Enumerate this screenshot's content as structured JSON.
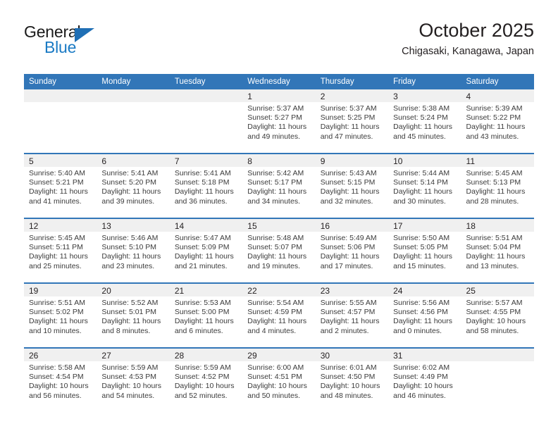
{
  "brand": {
    "name_line1": "General",
    "name_line2": "Blue",
    "primary_color": "#1a7ac4",
    "triangle_color": "#1f6fb5"
  },
  "header": {
    "title": "October 2025",
    "subtitle": "Chigasaki, Kanagawa, Japan"
  },
  "calendar": {
    "header_bg": "#3276b8",
    "daynum_bg": "#f0f0f0",
    "weekday_names": [
      "Sunday",
      "Monday",
      "Tuesday",
      "Wednesday",
      "Thursday",
      "Friday",
      "Saturday"
    ],
    "labels": {
      "sunrise": "Sunrise:",
      "sunset": "Sunset:",
      "daylight": "Daylight:"
    },
    "weeks": [
      [
        {
          "day": "",
          "blank": true
        },
        {
          "day": "",
          "blank": true
        },
        {
          "day": "",
          "blank": true
        },
        {
          "day": "1",
          "sunrise": "Sunrise: 5:37 AM",
          "sunset": "Sunset: 5:27 PM",
          "daylight_line1": "Daylight: 11 hours",
          "daylight_line2": "and 49 minutes."
        },
        {
          "day": "2",
          "sunrise": "Sunrise: 5:37 AM",
          "sunset": "Sunset: 5:25 PM",
          "daylight_line1": "Daylight: 11 hours",
          "daylight_line2": "and 47 minutes."
        },
        {
          "day": "3",
          "sunrise": "Sunrise: 5:38 AM",
          "sunset": "Sunset: 5:24 PM",
          "daylight_line1": "Daylight: 11 hours",
          "daylight_line2": "and 45 minutes."
        },
        {
          "day": "4",
          "sunrise": "Sunrise: 5:39 AM",
          "sunset": "Sunset: 5:22 PM",
          "daylight_line1": "Daylight: 11 hours",
          "daylight_line2": "and 43 minutes."
        }
      ],
      [
        {
          "day": "5",
          "sunrise": "Sunrise: 5:40 AM",
          "sunset": "Sunset: 5:21 PM",
          "daylight_line1": "Daylight: 11 hours",
          "daylight_line2": "and 41 minutes."
        },
        {
          "day": "6",
          "sunrise": "Sunrise: 5:41 AM",
          "sunset": "Sunset: 5:20 PM",
          "daylight_line1": "Daylight: 11 hours",
          "daylight_line2": "and 39 minutes."
        },
        {
          "day": "7",
          "sunrise": "Sunrise: 5:41 AM",
          "sunset": "Sunset: 5:18 PM",
          "daylight_line1": "Daylight: 11 hours",
          "daylight_line2": "and 36 minutes."
        },
        {
          "day": "8",
          "sunrise": "Sunrise: 5:42 AM",
          "sunset": "Sunset: 5:17 PM",
          "daylight_line1": "Daylight: 11 hours",
          "daylight_line2": "and 34 minutes."
        },
        {
          "day": "9",
          "sunrise": "Sunrise: 5:43 AM",
          "sunset": "Sunset: 5:15 PM",
          "daylight_line1": "Daylight: 11 hours",
          "daylight_line2": "and 32 minutes."
        },
        {
          "day": "10",
          "sunrise": "Sunrise: 5:44 AM",
          "sunset": "Sunset: 5:14 PM",
          "daylight_line1": "Daylight: 11 hours",
          "daylight_line2": "and 30 minutes."
        },
        {
          "day": "11",
          "sunrise": "Sunrise: 5:45 AM",
          "sunset": "Sunset: 5:13 PM",
          "daylight_line1": "Daylight: 11 hours",
          "daylight_line2": "and 28 minutes."
        }
      ],
      [
        {
          "day": "12",
          "sunrise": "Sunrise: 5:45 AM",
          "sunset": "Sunset: 5:11 PM",
          "daylight_line1": "Daylight: 11 hours",
          "daylight_line2": "and 25 minutes."
        },
        {
          "day": "13",
          "sunrise": "Sunrise: 5:46 AM",
          "sunset": "Sunset: 5:10 PM",
          "daylight_line1": "Daylight: 11 hours",
          "daylight_line2": "and 23 minutes."
        },
        {
          "day": "14",
          "sunrise": "Sunrise: 5:47 AM",
          "sunset": "Sunset: 5:09 PM",
          "daylight_line1": "Daylight: 11 hours",
          "daylight_line2": "and 21 minutes."
        },
        {
          "day": "15",
          "sunrise": "Sunrise: 5:48 AM",
          "sunset": "Sunset: 5:07 PM",
          "daylight_line1": "Daylight: 11 hours",
          "daylight_line2": "and 19 minutes."
        },
        {
          "day": "16",
          "sunrise": "Sunrise: 5:49 AM",
          "sunset": "Sunset: 5:06 PM",
          "daylight_line1": "Daylight: 11 hours",
          "daylight_line2": "and 17 minutes."
        },
        {
          "day": "17",
          "sunrise": "Sunrise: 5:50 AM",
          "sunset": "Sunset: 5:05 PM",
          "daylight_line1": "Daylight: 11 hours",
          "daylight_line2": "and 15 minutes."
        },
        {
          "day": "18",
          "sunrise": "Sunrise: 5:51 AM",
          "sunset": "Sunset: 5:04 PM",
          "daylight_line1": "Daylight: 11 hours",
          "daylight_line2": "and 13 minutes."
        }
      ],
      [
        {
          "day": "19",
          "sunrise": "Sunrise: 5:51 AM",
          "sunset": "Sunset: 5:02 PM",
          "daylight_line1": "Daylight: 11 hours",
          "daylight_line2": "and 10 minutes."
        },
        {
          "day": "20",
          "sunrise": "Sunrise: 5:52 AM",
          "sunset": "Sunset: 5:01 PM",
          "daylight_line1": "Daylight: 11 hours",
          "daylight_line2": "and 8 minutes."
        },
        {
          "day": "21",
          "sunrise": "Sunrise: 5:53 AM",
          "sunset": "Sunset: 5:00 PM",
          "daylight_line1": "Daylight: 11 hours",
          "daylight_line2": "and 6 minutes."
        },
        {
          "day": "22",
          "sunrise": "Sunrise: 5:54 AM",
          "sunset": "Sunset: 4:59 PM",
          "daylight_line1": "Daylight: 11 hours",
          "daylight_line2": "and 4 minutes."
        },
        {
          "day": "23",
          "sunrise": "Sunrise: 5:55 AM",
          "sunset": "Sunset: 4:57 PM",
          "daylight_line1": "Daylight: 11 hours",
          "daylight_line2": "and 2 minutes."
        },
        {
          "day": "24",
          "sunrise": "Sunrise: 5:56 AM",
          "sunset": "Sunset: 4:56 PM",
          "daylight_line1": "Daylight: 11 hours",
          "daylight_line2": "and 0 minutes."
        },
        {
          "day": "25",
          "sunrise": "Sunrise: 5:57 AM",
          "sunset": "Sunset: 4:55 PM",
          "daylight_line1": "Daylight: 10 hours",
          "daylight_line2": "and 58 minutes."
        }
      ],
      [
        {
          "day": "26",
          "sunrise": "Sunrise: 5:58 AM",
          "sunset": "Sunset: 4:54 PM",
          "daylight_line1": "Daylight: 10 hours",
          "daylight_line2": "and 56 minutes."
        },
        {
          "day": "27",
          "sunrise": "Sunrise: 5:59 AM",
          "sunset": "Sunset: 4:53 PM",
          "daylight_line1": "Daylight: 10 hours",
          "daylight_line2": "and 54 minutes."
        },
        {
          "day": "28",
          "sunrise": "Sunrise: 5:59 AM",
          "sunset": "Sunset: 4:52 PM",
          "daylight_line1": "Daylight: 10 hours",
          "daylight_line2": "and 52 minutes."
        },
        {
          "day": "29",
          "sunrise": "Sunrise: 6:00 AM",
          "sunset": "Sunset: 4:51 PM",
          "daylight_line1": "Daylight: 10 hours",
          "daylight_line2": "and 50 minutes."
        },
        {
          "day": "30",
          "sunrise": "Sunrise: 6:01 AM",
          "sunset": "Sunset: 4:50 PM",
          "daylight_line1": "Daylight: 10 hours",
          "daylight_line2": "and 48 minutes."
        },
        {
          "day": "31",
          "sunrise": "Sunrise: 6:02 AM",
          "sunset": "Sunset: 4:49 PM",
          "daylight_line1": "Daylight: 10 hours",
          "daylight_line2": "and 46 minutes."
        },
        {
          "day": "",
          "blank": true
        }
      ]
    ]
  }
}
